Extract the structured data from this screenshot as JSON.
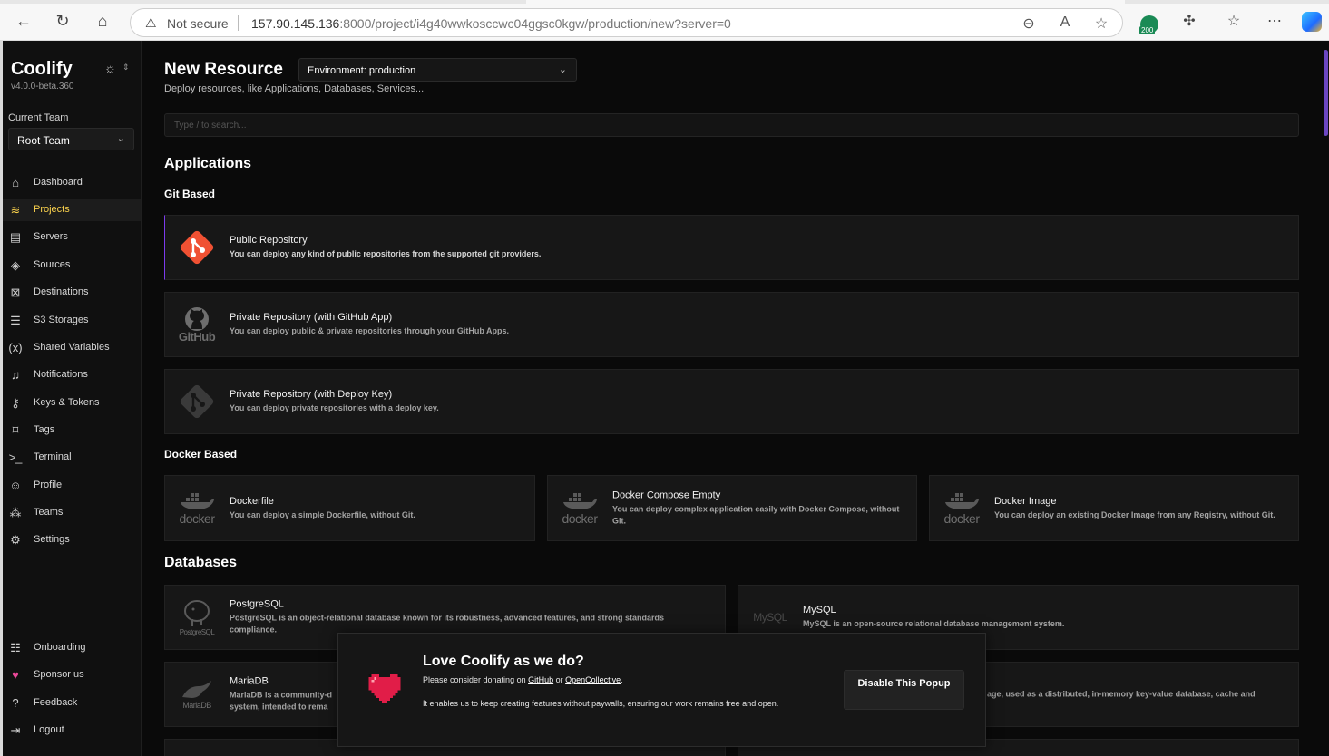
{
  "browser": {
    "security_label": "Not secure",
    "url_host": "157.90.145.136",
    "url_rest": ":8000/project/i4g40wwkosccwc04ggsc0kgw/production/new?server=0",
    "extension_badge": "200"
  },
  "sidebar": {
    "brand": "Coolify",
    "version": "v4.0.0-beta.360",
    "team_label": "Current Team",
    "team_value": "Root Team",
    "items": [
      {
        "label": "Dashboard",
        "icon": "home-icon"
      },
      {
        "label": "Projects",
        "icon": "layers-icon"
      },
      {
        "label": "Servers",
        "icon": "server-icon"
      },
      {
        "label": "Sources",
        "icon": "git-icon"
      },
      {
        "label": "Destinations",
        "icon": "map-icon"
      },
      {
        "label": "S3 Storages",
        "icon": "database-icon"
      },
      {
        "label": "Shared Variables",
        "icon": "variable-icon"
      },
      {
        "label": "Notifications",
        "icon": "bell-icon"
      },
      {
        "label": "Keys & Tokens",
        "icon": "key-icon"
      },
      {
        "label": "Tags",
        "icon": "tag-icon"
      },
      {
        "label": "Terminal",
        "icon": "terminal-icon"
      },
      {
        "label": "Profile",
        "icon": "user-icon"
      },
      {
        "label": "Teams",
        "icon": "users-icon"
      },
      {
        "label": "Settings",
        "icon": "gear-icon"
      }
    ],
    "bottom_items": [
      {
        "label": "Onboarding",
        "icon": "list-icon"
      },
      {
        "label": "Sponsor us",
        "icon": "heart-icon"
      },
      {
        "label": "Feedback",
        "icon": "help-icon"
      },
      {
        "label": "Logout",
        "icon": "logout-icon"
      }
    ],
    "active_color": "#fcd34d"
  },
  "main": {
    "title": "New Resource",
    "environment": "Environment: production",
    "subtitle": "Deploy resources, like Applications, Databases, Services...",
    "search_placeholder": "Type / to search...",
    "applications_heading": "Applications",
    "git_heading": "Git Based",
    "docker_heading": "Docker Based",
    "databases_heading": "Databases",
    "git_cards": [
      {
        "title": "Public Repository",
        "desc": "You can deploy any kind of public repositories from the supported git providers."
      },
      {
        "title": "Private Repository (with GitHub App)",
        "desc": "You can deploy public & private repositories through your GitHub Apps.",
        "logo_text": "GitHub"
      },
      {
        "title": "Private Repository (with Deploy Key)",
        "desc": "You can deploy private repositories with a deploy key."
      }
    ],
    "docker_cards": [
      {
        "title": "Dockerfile",
        "desc": "You can deploy a simple Dockerfile, without Git.",
        "logo_text": "docker"
      },
      {
        "title": "Docker Compose Empty",
        "desc": "You can deploy complex application easily with Docker Compose, without Git.",
        "logo_text": "docker"
      },
      {
        "title": "Docker Image",
        "desc": "You can deploy an existing Docker Image from any Registry, without Git.",
        "logo_text": "docker"
      }
    ],
    "db_cards": [
      {
        "title": "PostgreSQL",
        "desc": "PostgreSQL is an object-relational database known for its robustness, advanced features, and strong standards compliance.",
        "logo_text": "PostgreSQL"
      },
      {
        "title": "MySQL",
        "desc": "MySQL is an open-source relational database management system.",
        "logo_text": "MySQL"
      },
      {
        "title": "MariaDB",
        "desc": "MariaDB is a community-d",
        "desc2": "system, intended to rema",
        "logo_text": "MariaDB"
      },
      {
        "title": "",
        "desc": "age, used as a distributed, in-memory key-value database, cache and"
      }
    ]
  },
  "popup": {
    "title": "Love Coolify as we do?",
    "line1_prefix": "Please consider donating on ",
    "link_github": "GitHub",
    "line1_mid": " or ",
    "link_oc": "OpenCollective",
    "line1_suffix": ".",
    "line2": "It enables us to keep creating features without paywalls, ensuring our work remains free and open.",
    "button": "Disable This Popup"
  }
}
